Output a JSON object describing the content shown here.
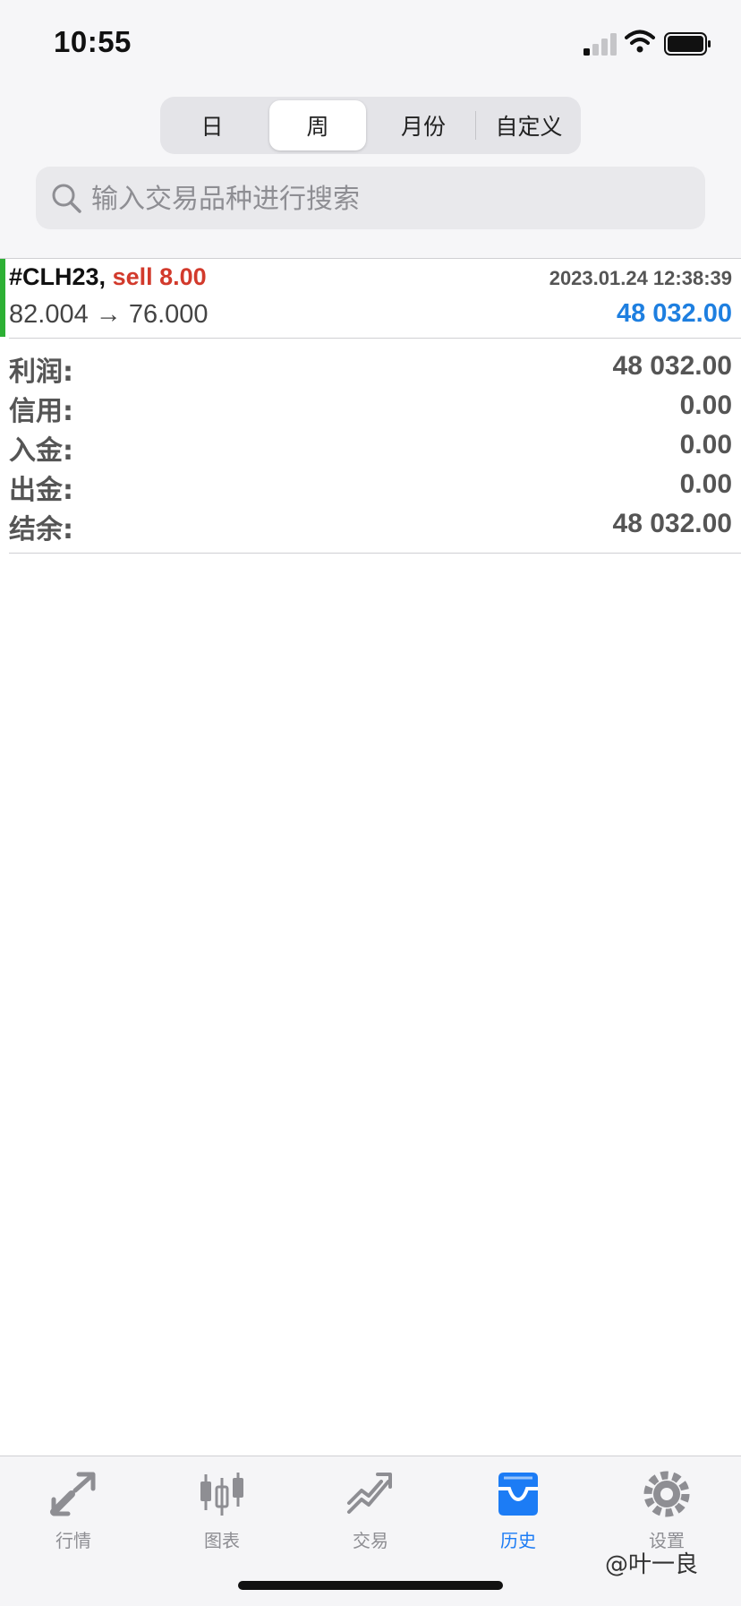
{
  "status_bar": {
    "time": "10:55"
  },
  "period_tabs": [
    {
      "label": "日",
      "active": false
    },
    {
      "label": "周",
      "active": true
    },
    {
      "label": "月份",
      "active": false
    },
    {
      "label": "自定义",
      "active": false
    }
  ],
  "search": {
    "placeholder": "输入交易品种进行搜索"
  },
  "deal": {
    "symbol": "#CLH23,",
    "side": "sell 8.00",
    "datetime": "2023.01.24 12:38:39",
    "prices": "82.004 → 76.000",
    "profit": "48 032.00"
  },
  "summary": [
    {
      "label": "利润:",
      "value": "48 032.00"
    },
    {
      "label": "信用:",
      "value": "0.00"
    },
    {
      "label": "入金:",
      "value": "0.00"
    },
    {
      "label": "出金:",
      "value": "0.00"
    },
    {
      "label": "结余:",
      "value": "48 032.00"
    }
  ],
  "tab_bar": [
    {
      "label": "行情",
      "icon": "quotes-icon",
      "active": false
    },
    {
      "label": "图表",
      "icon": "chart-icon",
      "active": false
    },
    {
      "label": "交易",
      "icon": "trade-icon",
      "active": false
    },
    {
      "label": "历史",
      "icon": "history-icon",
      "active": true
    },
    {
      "label": "设置",
      "icon": "settings-icon",
      "active": false
    }
  ],
  "watermark": "@叶一良",
  "colors": {
    "accent": "#1c7cf5",
    "sell": "#d23a2c",
    "profit": "#1e7fe0",
    "deal_bar": "#2db034"
  }
}
